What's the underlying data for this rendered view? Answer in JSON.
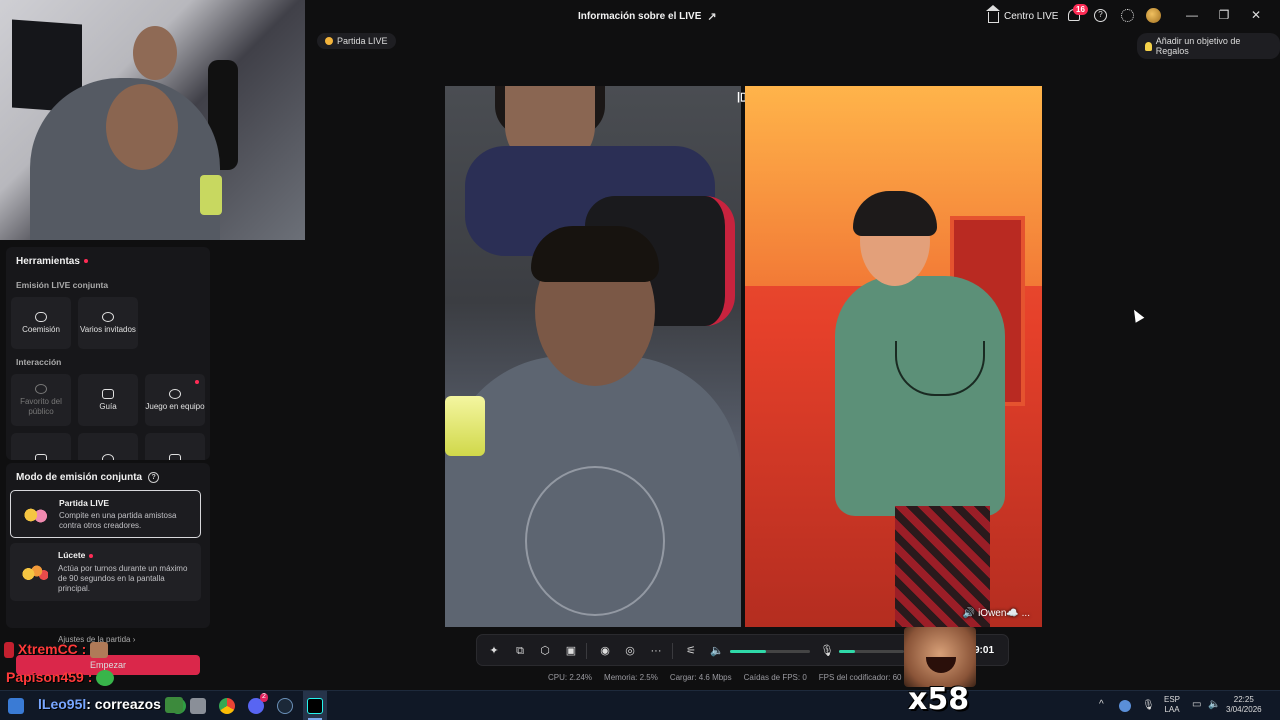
{
  "header": {
    "live_info": "Información sobre el LIVE",
    "centro_live": "Centro LIVE",
    "notif_count": "16",
    "help": "?"
  },
  "window": {
    "minimize": "—",
    "restore": "❐",
    "close": "✕"
  },
  "pills": {
    "partida": "Partida LIVE",
    "gift_goal": "Añadir un objetivo de Regalos"
  },
  "tools": {
    "title": "Herramientas",
    "section_coemision": "Emisión LIVE conjunta",
    "coemision": "Coemisión",
    "varios": "Varios invitados",
    "section_interaccion": "Interacción",
    "favorito": "Favorito del público",
    "guia": "Guía",
    "juego": "Juego en equipo"
  },
  "modo": {
    "title": "Modo de emisión conjunta",
    "opt1_title": "Partida LIVE",
    "opt1_desc": "Compite en una partida amistosa contra otros creadores.",
    "opt2_title": "Lúcete",
    "opt2_desc": "Actúa por turnos durante un máximo de 90 segundos en la pantalla principal.",
    "ajustes": "Ajustes de la partida ›",
    "empezar": "Empezar"
  },
  "chat": {
    "line1": "XtremCC :",
    "line2": "Papison459 :",
    "line3_name": "lLeo95l",
    "line3_text": ": correazos"
  },
  "stage": {
    "guest_name": "iOwen☁️ ..."
  },
  "controls": {
    "timer": "9:01",
    "volume_level": 0.45,
    "mic_level": 0.25
  },
  "stats": {
    "cpu": "CPU: 2.24%",
    "mem": "Memoria: 2.5%",
    "upload": "Cargar: 4.6 Mbps",
    "drops": "Caídas de FPS: 0",
    "encoder": "FPS del codificador: 60"
  },
  "overlay": {
    "multiplier": "x58"
  },
  "taskbar": {
    "lang1": "ESP",
    "lang2": "LAA",
    "time": "22:25",
    "date": "3/04/2026",
    "discord_badge": "2"
  },
  "colors": {
    "accent": "#fe2c55",
    "meter": "#2fd9a8",
    "bg": "#0f0f10"
  }
}
